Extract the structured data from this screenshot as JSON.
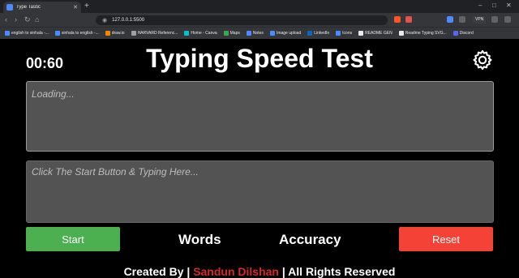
{
  "browser": {
    "tab_title": "Type Tastic",
    "url": "127.0.0.1:5500",
    "vpn_label": "VPN",
    "bookmarks": [
      {
        "label": "english to sinhala -...",
        "color": "#4a8cff"
      },
      {
        "label": "sinhala to english -...",
        "color": "#4a8cff"
      },
      {
        "label": "draw.io",
        "color": "#f08705"
      },
      {
        "label": "HARVARD Referenc...",
        "color": "#9aa0a6"
      },
      {
        "label": "Home - Canva",
        "color": "#00c4cc"
      },
      {
        "label": "Maps",
        "color": "#34a853"
      },
      {
        "label": "Notes",
        "color": "#4a8cff"
      },
      {
        "label": "Image upload",
        "color": "#4a8cff"
      },
      {
        "label": "LinkedIn",
        "color": "#0a66c2"
      },
      {
        "label": "Icons",
        "color": "#4a8cff"
      },
      {
        "label": "README GEN",
        "color": "#e8eaed"
      },
      {
        "label": "Readme Typing SVG...",
        "color": "#e8eaed"
      },
      {
        "label": "Discord",
        "color": "#5865f2"
      }
    ]
  },
  "app": {
    "timer": "00:60",
    "title": "Typing Speed Test",
    "quote_text": "Loading...",
    "input_placeholder": "Click The Start Button & Typing Here...",
    "start_label": "Start",
    "reset_label": "Reset",
    "words_label": "Words",
    "accuracy_label": "Accuracy",
    "footer_prefix": "Created By |",
    "footer_author": "Sandun Dilshan",
    "footer_suffix": "| All Rights Reserved"
  },
  "colors": {
    "start": "#4caf50",
    "reset": "#f44336",
    "author": "#d62828"
  }
}
